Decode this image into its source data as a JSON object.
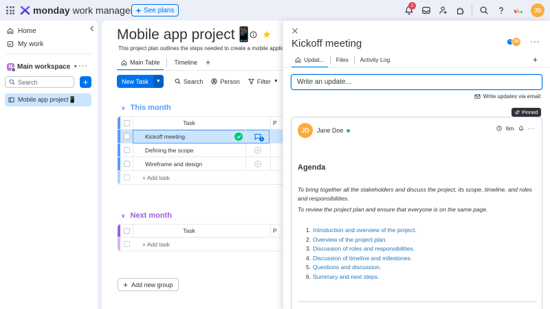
{
  "topbar": {
    "brand_bold": "monday",
    "brand_rest": "work management",
    "see_plans": "See plans",
    "notification_count": "1",
    "avatar_initials": "JD",
    "icons": [
      "apps-grid-icon",
      "bell-icon",
      "inbox-icon",
      "invite-user-icon",
      "apps-puzzle-icon",
      "search-icon",
      "help-icon"
    ]
  },
  "sidebar": {
    "home": "Home",
    "my_work": "My work",
    "workspace_badge": "M",
    "workspace_name": "Main workspace",
    "search_placeholder": "Search",
    "board_item": "Mobile app project📱"
  },
  "board": {
    "title": "Mobile app project📱",
    "description": "This project plan outlines the steps needed to create a mobile applicati",
    "tabs": [
      {
        "label": "Main Table"
      },
      {
        "label": "Timeline"
      }
    ],
    "toolbar": {
      "new_task": "New Task",
      "search": "Search",
      "person": "Person",
      "filter": "Filter"
    },
    "groups": [
      {
        "title": "This month",
        "color": "#579bfc",
        "header": "Task",
        "col2_header": "P",
        "rows": [
          "Kickoff meeting",
          "Defining the scope",
          "Wireframe and design"
        ],
        "add_label": "+ Add task"
      },
      {
        "title": "Next month",
        "color": "#a25ddc",
        "header": "Task",
        "col2_header": "P",
        "rows": [],
        "add_label": "+ Add task"
      }
    ],
    "add_group": "Add new group"
  },
  "panel": {
    "title": "Kickoff meeting",
    "avatar_initials": "JD",
    "tabs": [
      "Updat...",
      "Files",
      "Activity Log"
    ],
    "write_update": "Write an update...",
    "via_email": "Write updates via email:",
    "pinned": "Pinned",
    "update": {
      "author_initials": "JD",
      "author": "Jane Doe",
      "time": "6m",
      "heading": "Agenda",
      "para1": "To bring together all the stakeholders and discuss the project, its scope, timeline, and roles and responsibilities.",
      "para2": "To review the project plan and ensure that everyone is on the same page.",
      "list": [
        {
          "n": "1.",
          "t": "Introduction and overview of the project."
        },
        {
          "n": "2.",
          "t": "Overview of the project plan."
        },
        {
          "n": "3.",
          "t": "Discussion of roles and responsibilities."
        },
        {
          "n": "4.",
          "t": "Discussion of timeline and milestones."
        },
        {
          "n": "5.",
          "t": "Questions and discussion."
        },
        {
          "n": "6.",
          "t": "Summary and next steps."
        }
      ]
    }
  },
  "colors": {
    "accent": "#0073ea",
    "success": "#00c875",
    "this_month": "#579bfc",
    "next_month": "#a25ddc",
    "avatar": "#fdab3d",
    "notification": "#e2445c"
  }
}
